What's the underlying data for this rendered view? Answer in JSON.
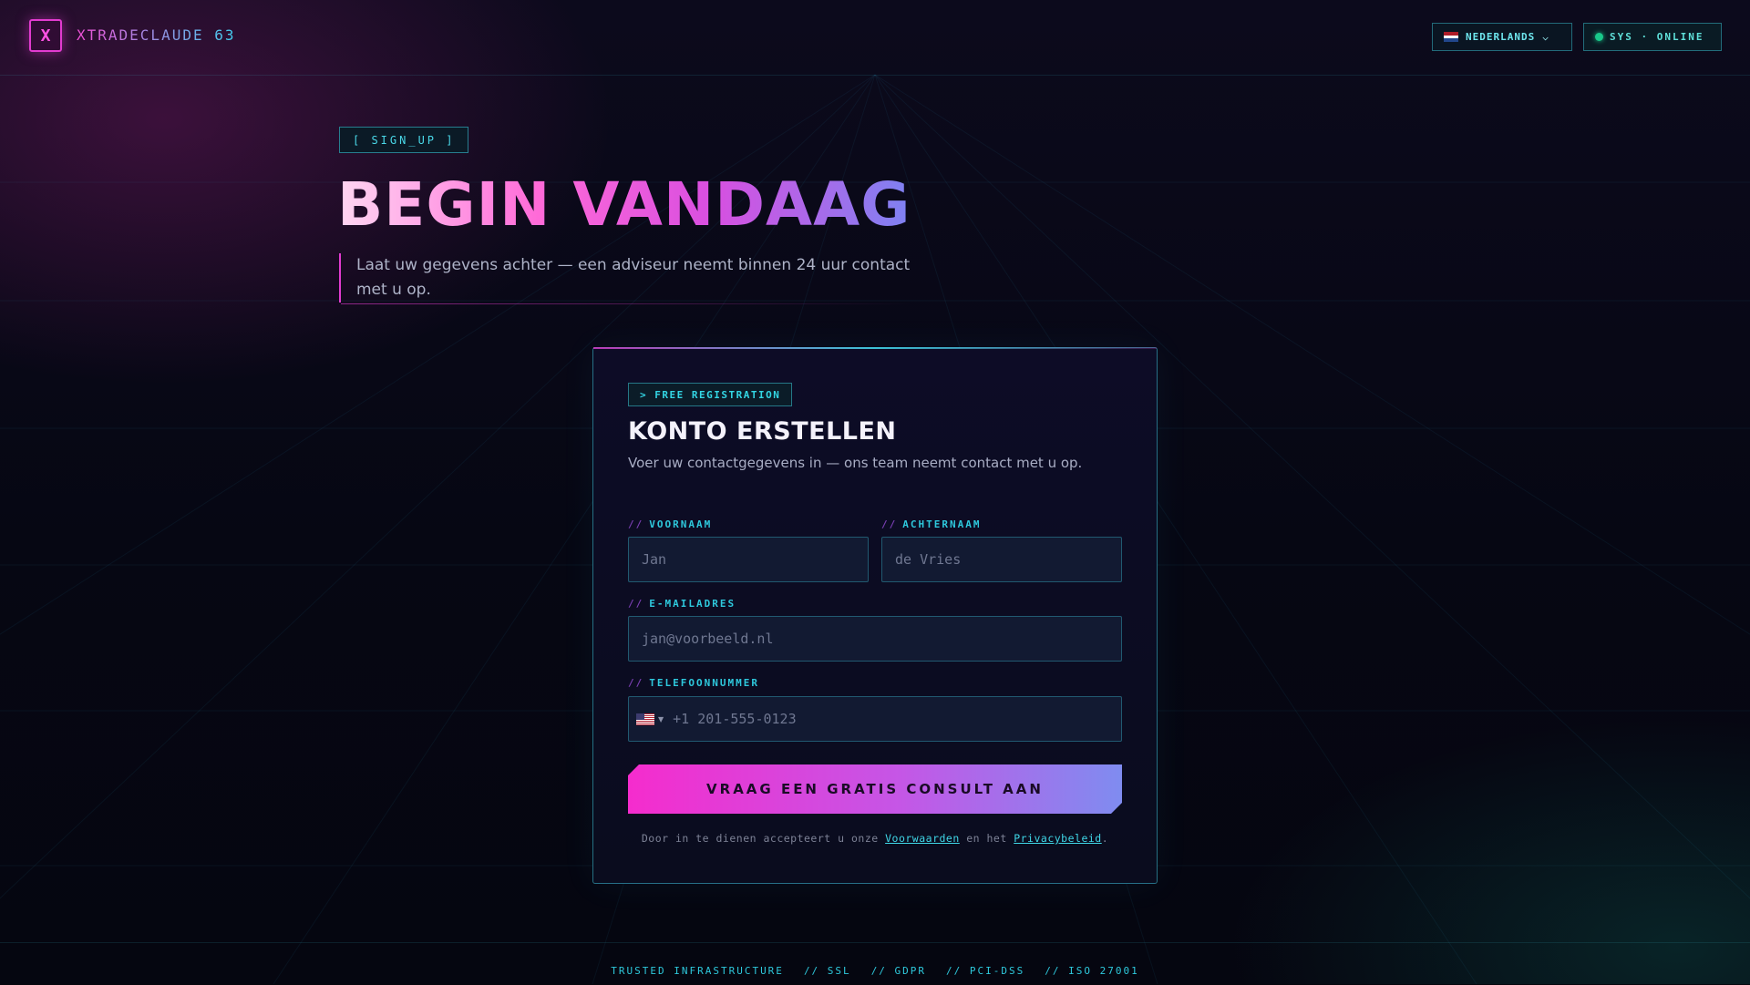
{
  "header": {
    "logo_letter": "X",
    "brand": "XTRADECLAUDE 63",
    "language": "NEDERLANDS",
    "status": "SYS · ONLINE"
  },
  "hero": {
    "tag": "[ SIGN_UP ]",
    "title": "BEGIN VANDAAG",
    "subtitle": "Laat uw gegevens achter — een adviseur neemt binnen 24 uur contact met u op."
  },
  "form": {
    "tag": "> FREE REGISTRATION",
    "title": "KONTO ERSTELLEN",
    "subtitle": "Voer uw contactgegevens in — ons team neemt contact met u op.",
    "label_prefix": "//",
    "first_name": {
      "label": "VOORNAAM",
      "placeholder": "Jan"
    },
    "last_name": {
      "label": "ACHTERNAAM",
      "placeholder": "de Vries"
    },
    "email": {
      "label": "E-MAILADRES",
      "placeholder": "jan@voorbeeld.nl"
    },
    "phone": {
      "label": "TELEFOONNUMMER",
      "placeholder": "+1 201-555-0123",
      "country_flag": "us-flag-icon"
    },
    "submit_label": "VRAAG EEN GRATIS CONSULT AAN",
    "terms": {
      "before": "Door in te dienen accepteert u onze",
      "terms_link": "Voorwaarden",
      "middle": "en het",
      "privacy_link": "Privacybeleid",
      "after": "."
    }
  },
  "footer": {
    "items": [
      "TRUSTED INFRASTRUCTURE",
      "// SSL",
      "// GDPR",
      "// PCI-DSS",
      "// ISO 27001"
    ]
  },
  "colors": {
    "accent_pink": "#e23bd0",
    "accent_cyan": "#40d2e6",
    "status_green": "#19c98a"
  }
}
